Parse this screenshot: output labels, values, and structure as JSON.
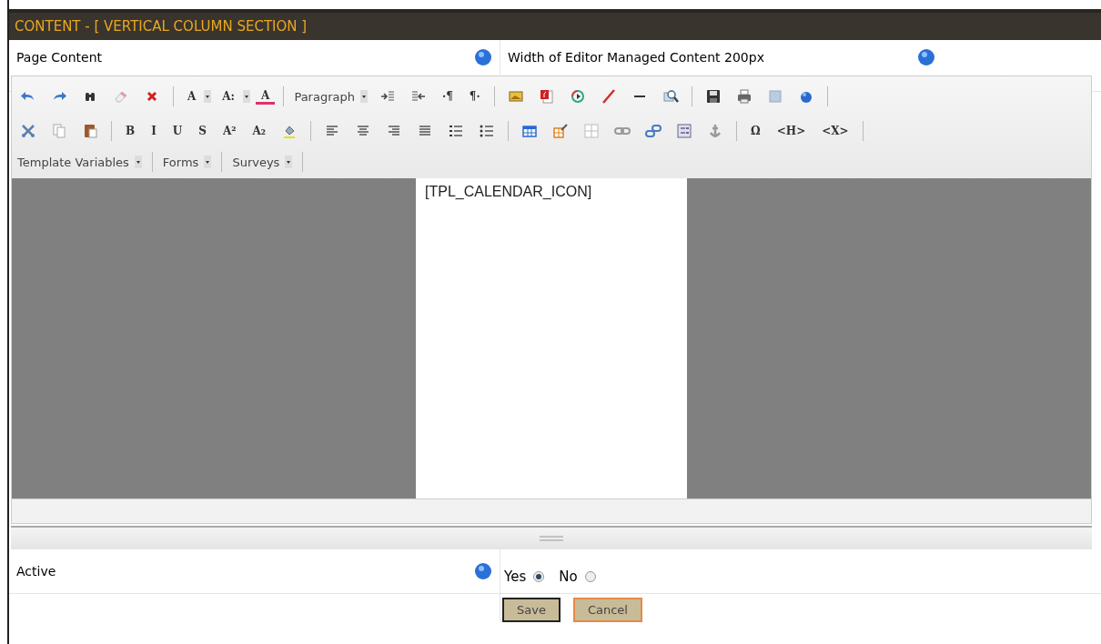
{
  "header": {
    "title": "CONTENT - [ VERTICAL COLUMN SECTION ]"
  },
  "content_row": {
    "label": "Page Content",
    "width_note": "Width of Editor Managed Content 200px"
  },
  "toolbar": {
    "rows": [
      {
        "items": [
          {
            "kind": "icon"
          },
          {
            "kind": "icon"
          },
          {
            "kind": "icon"
          },
          {
            "kind": "icon"
          },
          {
            "kind": "icon"
          },
          {
            "kind": "separator"
          },
          {
            "kind": "dropdown_glyph",
            "text": "A"
          },
          {
            "kind": "dropdown_glyph",
            "text": "A:"
          },
          {
            "kind": "color_glyph",
            "text": "A"
          },
          {
            "kind": "separator"
          },
          {
            "kind": "combo",
            "text": "Paragraph"
          },
          {
            "kind": "icon"
          },
          {
            "kind": "icon"
          },
          {
            "kind": "glyph",
            "text": "·¶"
          },
          {
            "kind": "glyph",
            "text": "¶·"
          },
          {
            "kind": "separator"
          },
          {
            "kind": "icon"
          },
          {
            "kind": "icon"
          },
          {
            "kind": "icon"
          },
          {
            "kind": "icon"
          },
          {
            "kind": "icon"
          },
          {
            "kind": "icon"
          },
          {
            "kind": "separator"
          },
          {
            "kind": "icon"
          },
          {
            "kind": "icon"
          },
          {
            "kind": "icon"
          },
          {
            "kind": "icon"
          },
          {
            "kind": "separator"
          }
        ]
      },
      {
        "items": [
          {
            "kind": "icon"
          },
          {
            "kind": "icon"
          },
          {
            "kind": "icon"
          },
          {
            "kind": "separator"
          },
          {
            "kind": "glyph",
            "text": "B"
          },
          {
            "kind": "glyph",
            "text": "I"
          },
          {
            "kind": "glyph",
            "text": "U"
          },
          {
            "kind": "glyph",
            "text": "S"
          },
          {
            "kind": "glyph",
            "text": "A²"
          },
          {
            "kind": "glyph",
            "text": "A₂"
          },
          {
            "kind": "icon"
          },
          {
            "kind": "separator"
          },
          {
            "kind": "icon"
          },
          {
            "kind": "icon"
          },
          {
            "kind": "icon"
          },
          {
            "kind": "icon"
          },
          {
            "kind": "icon"
          },
          {
            "kind": "icon"
          },
          {
            "kind": "separator"
          },
          {
            "kind": "icon"
          },
          {
            "kind": "icon"
          },
          {
            "kind": "icon"
          },
          {
            "kind": "icon"
          },
          {
            "kind": "icon"
          },
          {
            "kind": "icon"
          },
          {
            "kind": "icon"
          },
          {
            "kind": "separator"
          },
          {
            "kind": "glyph",
            "text": "Ω"
          },
          {
            "kind": "glyph",
            "text": "<H>"
          },
          {
            "kind": "glyph",
            "text": "<X>"
          },
          {
            "kind": "separator"
          }
        ]
      },
      {
        "items": [
          {
            "kind": "combo",
            "text": "Template Variables"
          },
          {
            "kind": "separator"
          },
          {
            "kind": "combo",
            "text": "Forms"
          },
          {
            "kind": "separator"
          },
          {
            "kind": "combo",
            "text": "Surveys"
          },
          {
            "kind": "separator"
          }
        ]
      }
    ]
  },
  "editor": {
    "text": "[TPL_CALENDAR_ICON]"
  },
  "active_row": {
    "label": "Active",
    "options": [
      {
        "label": "Yes",
        "selected": true
      },
      {
        "label": "No",
        "selected": false
      }
    ]
  },
  "buttons": [
    {
      "label": "Save",
      "focused": true
    },
    {
      "label": "Cancel",
      "focused": false
    }
  ]
}
